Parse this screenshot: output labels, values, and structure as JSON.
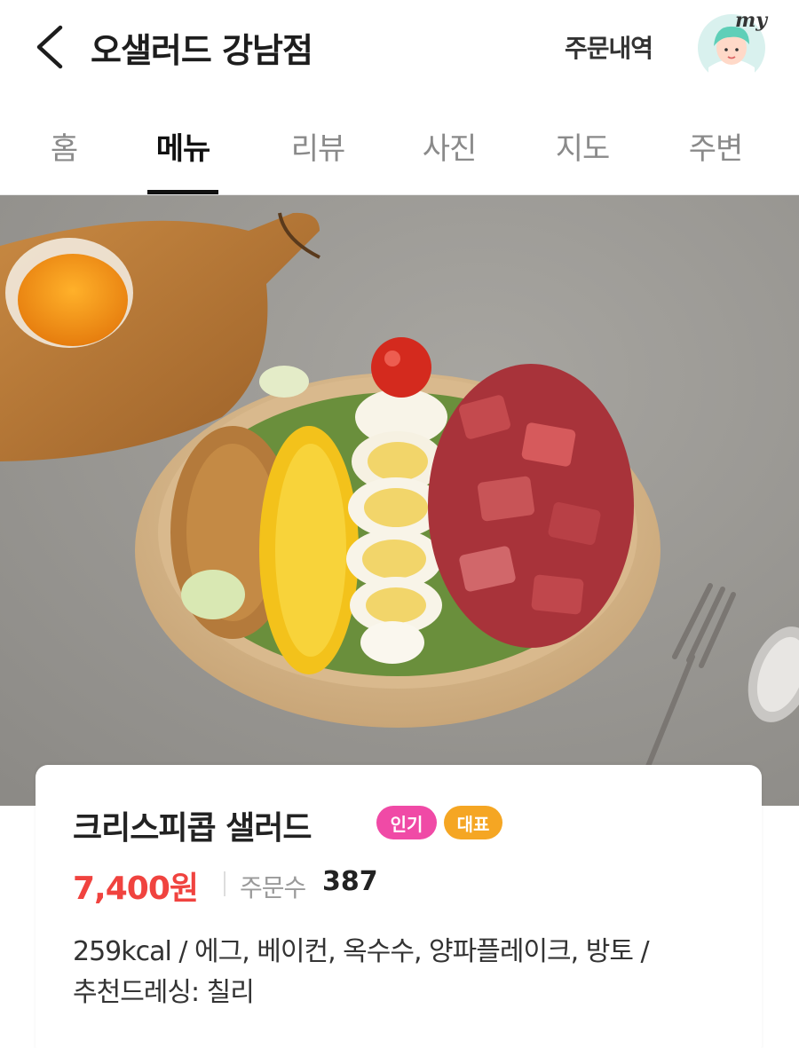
{
  "header": {
    "title": "오샐러드 강남점",
    "order_history": "주문내역",
    "avatar_label": "my"
  },
  "tabs": [
    {
      "label": "홈",
      "active": false
    },
    {
      "label": "메뉴",
      "active": true
    },
    {
      "label": "리뷰",
      "active": false
    },
    {
      "label": "사진",
      "active": false
    },
    {
      "label": "지도",
      "active": false
    },
    {
      "label": "주변",
      "active": false
    }
  ],
  "item": {
    "name": "크리스피콥 샐러드",
    "badges": [
      "인기",
      "대표"
    ],
    "price": "7,400원",
    "order_count_label": "주문수",
    "order_count": "387",
    "description_line1": "259kcal / 에그, 베이컨, 옥수수, 양파플레이크, 방토 /",
    "description_line2": "추천드레싱: 칠리"
  },
  "colors": {
    "price": "#f0433f",
    "badge_popular": "#f04aa6",
    "badge_representative": "#f5a623",
    "tab_active": "#111111",
    "tab_inactive": "#8a8a8a"
  },
  "icons": [
    "back-arrow-icon",
    "avatar-icon"
  ]
}
